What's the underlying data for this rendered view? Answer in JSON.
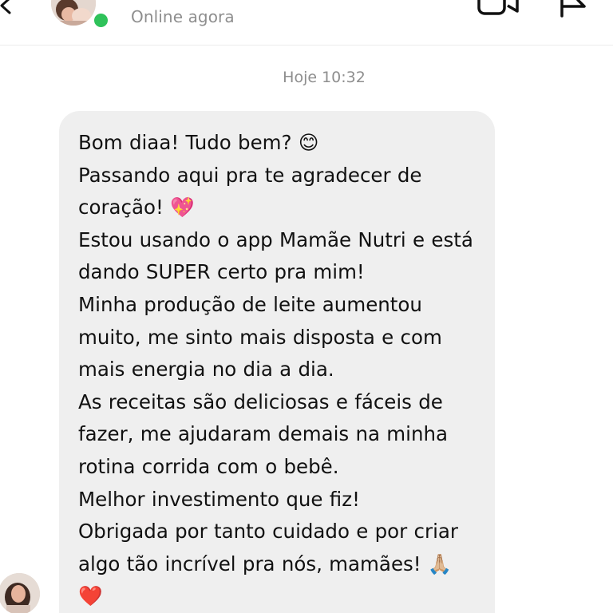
{
  "header": {
    "status": "Online agora",
    "icons": {
      "back": "chevron-left-icon",
      "video": "video-camera-icon",
      "flag": "flag-icon"
    },
    "online_color": "#2fc25a"
  },
  "conversation": {
    "timestamp": "Hoje 10:32",
    "message": {
      "text": "Bom diaa! Tudo bem? 😊\nPassando aqui pra te agradecer de coração! 💖\nEstou usando o app Mamãe Nutri e está dando SUPER certo pra mim!\nMinha produção de leite aumentou muito, me sinto mais disposta e com mais energia no dia a dia.\nAs receitas são deliciosas e fáceis de fazer, me ajudaram demais na minha rotina corrida com o bebê.\nMelhor investimento que fiz!\nObrigada por tanto cuidado e por criar algo tão incrível pra nós, mamães! 🙏🏼❤️",
      "bubble_color": "#efefef"
    }
  }
}
